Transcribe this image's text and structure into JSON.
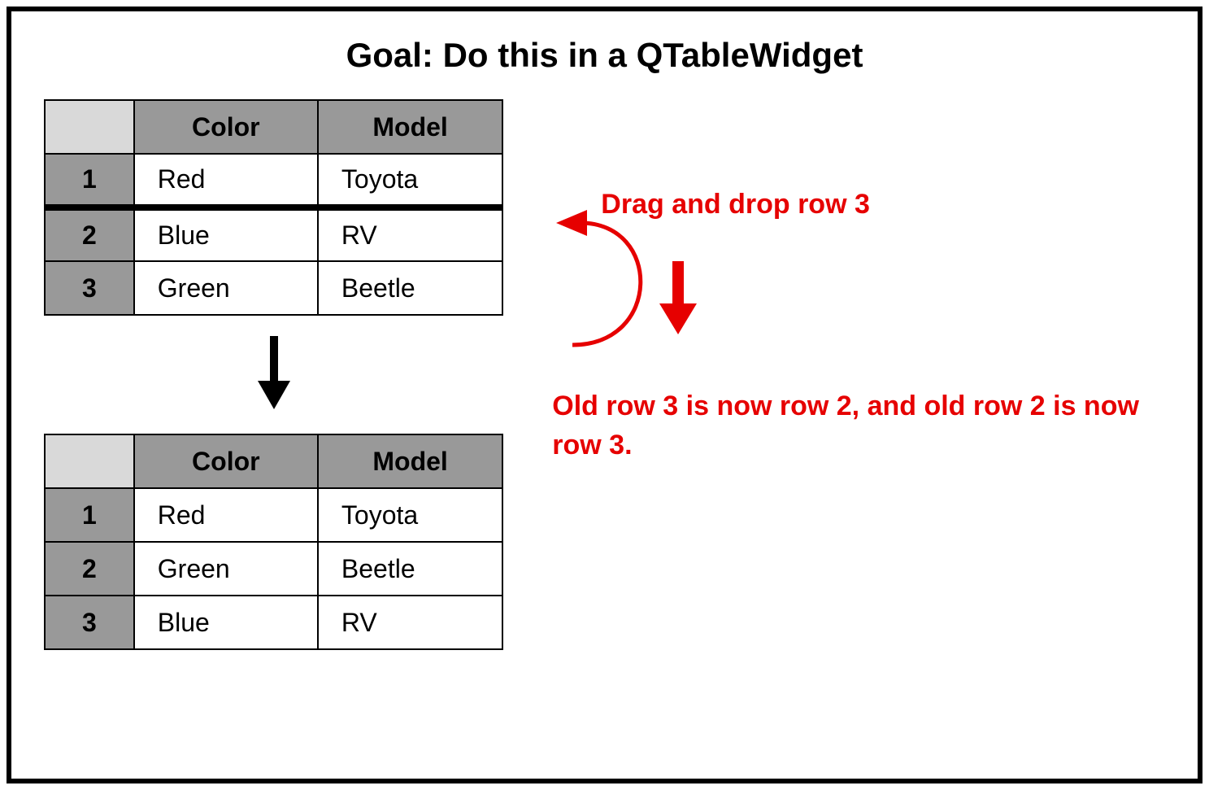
{
  "title": "Goal: Do this in a QTableWidget",
  "table_before": {
    "columns": [
      "Color",
      "Model"
    ],
    "rows": [
      {
        "num": "1",
        "color": "Red",
        "model": "Toyota"
      },
      {
        "num": "2",
        "color": "Blue",
        "model": "RV"
      },
      {
        "num": "3",
        "color": "Green",
        "model": "Beetle"
      }
    ]
  },
  "table_after": {
    "columns": [
      "Color",
      "Model"
    ],
    "rows": [
      {
        "num": "1",
        "color": "Red",
        "model": "Toyota"
      },
      {
        "num": "2",
        "color": "Green",
        "model": "Beetle"
      },
      {
        "num": "3",
        "color": "Blue",
        "model": "RV"
      }
    ]
  },
  "annotation1": "Drag and drop row 3",
  "annotation2": "Old row 3 is now row 2, and old row 2 is now row 3."
}
